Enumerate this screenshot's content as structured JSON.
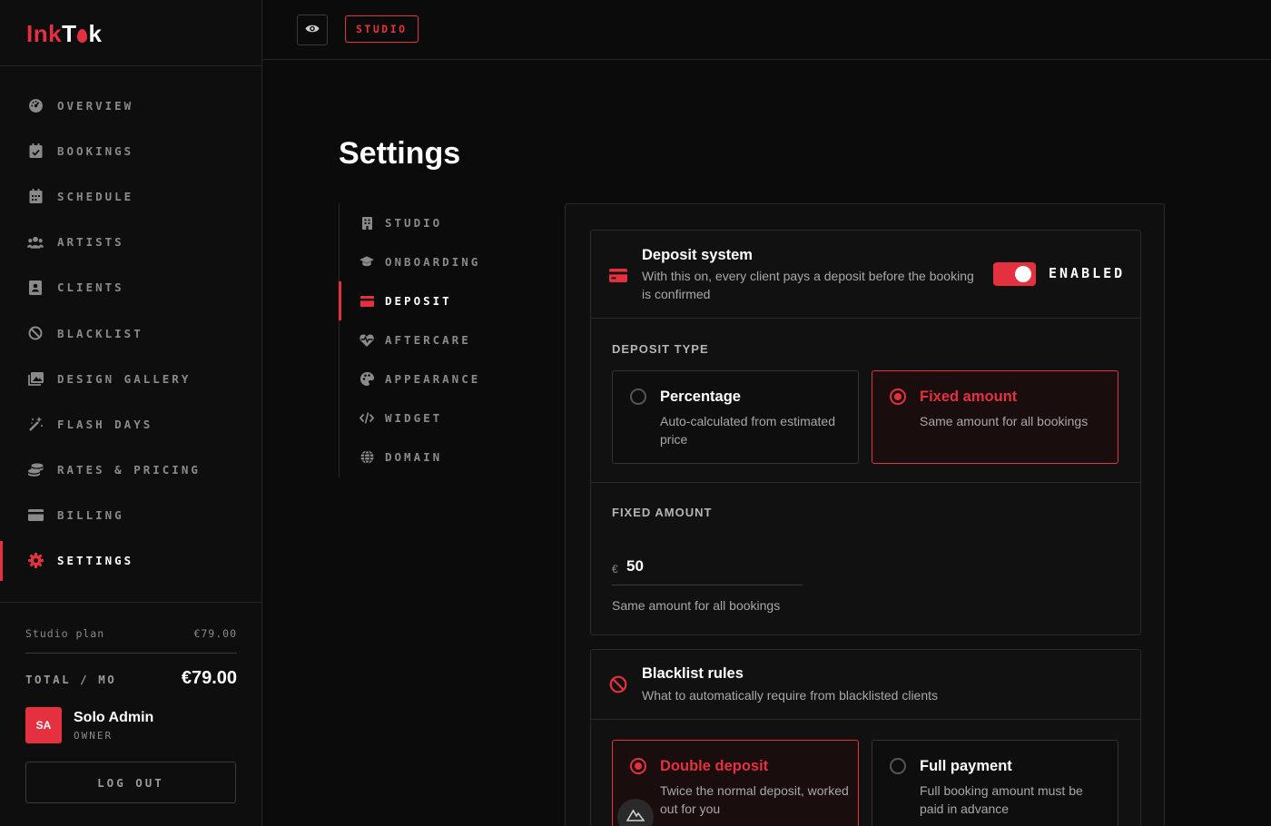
{
  "brand": {
    "left": "Ink",
    "right_a": "T",
    "right_b": "k"
  },
  "sidebar": {
    "items": [
      {
        "label": "OVERVIEW",
        "icon": "dashboard-icon"
      },
      {
        "label": "BOOKINGS",
        "icon": "calendar-check-icon"
      },
      {
        "label": "SCHEDULE",
        "icon": "calendar-icon"
      },
      {
        "label": "ARTISTS",
        "icon": "people-icon"
      },
      {
        "label": "CLIENTS",
        "icon": "contact-book-icon"
      },
      {
        "label": "BLACKLIST",
        "icon": "block-icon"
      },
      {
        "label": "DESIGN GALLERY",
        "icon": "gallery-icon"
      },
      {
        "label": "FLASH DAYS",
        "icon": "magic-wand-icon"
      },
      {
        "label": "RATES & PRICING",
        "icon": "coins-icon"
      },
      {
        "label": "BILLING",
        "icon": "credit-card-icon"
      },
      {
        "label": "SETTINGS",
        "icon": "gear-icon",
        "active": true
      }
    ],
    "plan_label": "Studio plan",
    "plan_price": "€79.00",
    "total_label": "TOTAL / MO",
    "total_value": "€79.00",
    "user": {
      "initials": "SA",
      "name": "Solo Admin",
      "role": "OWNER"
    },
    "logout_label": "LOG OUT"
  },
  "topbar": {
    "badge": "STUDIO"
  },
  "page_title": "Settings",
  "subnav": {
    "items": [
      {
        "label": "STUDIO",
        "icon": "building-icon"
      },
      {
        "label": "ONBOARDING",
        "icon": "graduation-cap-icon"
      },
      {
        "label": "DEPOSIT",
        "icon": "credit-card-icon",
        "active": true
      },
      {
        "label": "AFTERCARE",
        "icon": "heart-pulse-icon"
      },
      {
        "label": "APPEARANCE",
        "icon": "palette-icon"
      },
      {
        "label": "WIDGET",
        "icon": "code-icon"
      },
      {
        "label": "DOMAIN",
        "icon": "globe-icon"
      }
    ]
  },
  "deposit": {
    "title": "Deposit system",
    "description": "With this on, every client pays a deposit before the booking is confirmed",
    "toggle_label": "ENABLED",
    "enabled": true,
    "type_label": "DEPOSIT TYPE",
    "options": [
      {
        "title": "Percentage",
        "desc": "Auto-calculated from estimated price",
        "selected": false
      },
      {
        "title": "Fixed amount",
        "desc": "Same amount for all bookings",
        "selected": true
      }
    ],
    "amount_label": "FIXED AMOUNT",
    "currency": "€",
    "amount": "50",
    "amount_help": "Same amount for all bookings"
  },
  "blacklist": {
    "title": "Blacklist rules",
    "description": "What to automatically require from blacklisted clients",
    "options": [
      {
        "title": "Double deposit",
        "desc": "Twice the normal deposit, worked out for you",
        "selected": true
      },
      {
        "title": "Full payment",
        "desc": "Full booking amount must be paid in advance",
        "selected": false
      }
    ]
  },
  "colors": {
    "accent": "#e5303f",
    "bg": "#0b0b0b"
  }
}
